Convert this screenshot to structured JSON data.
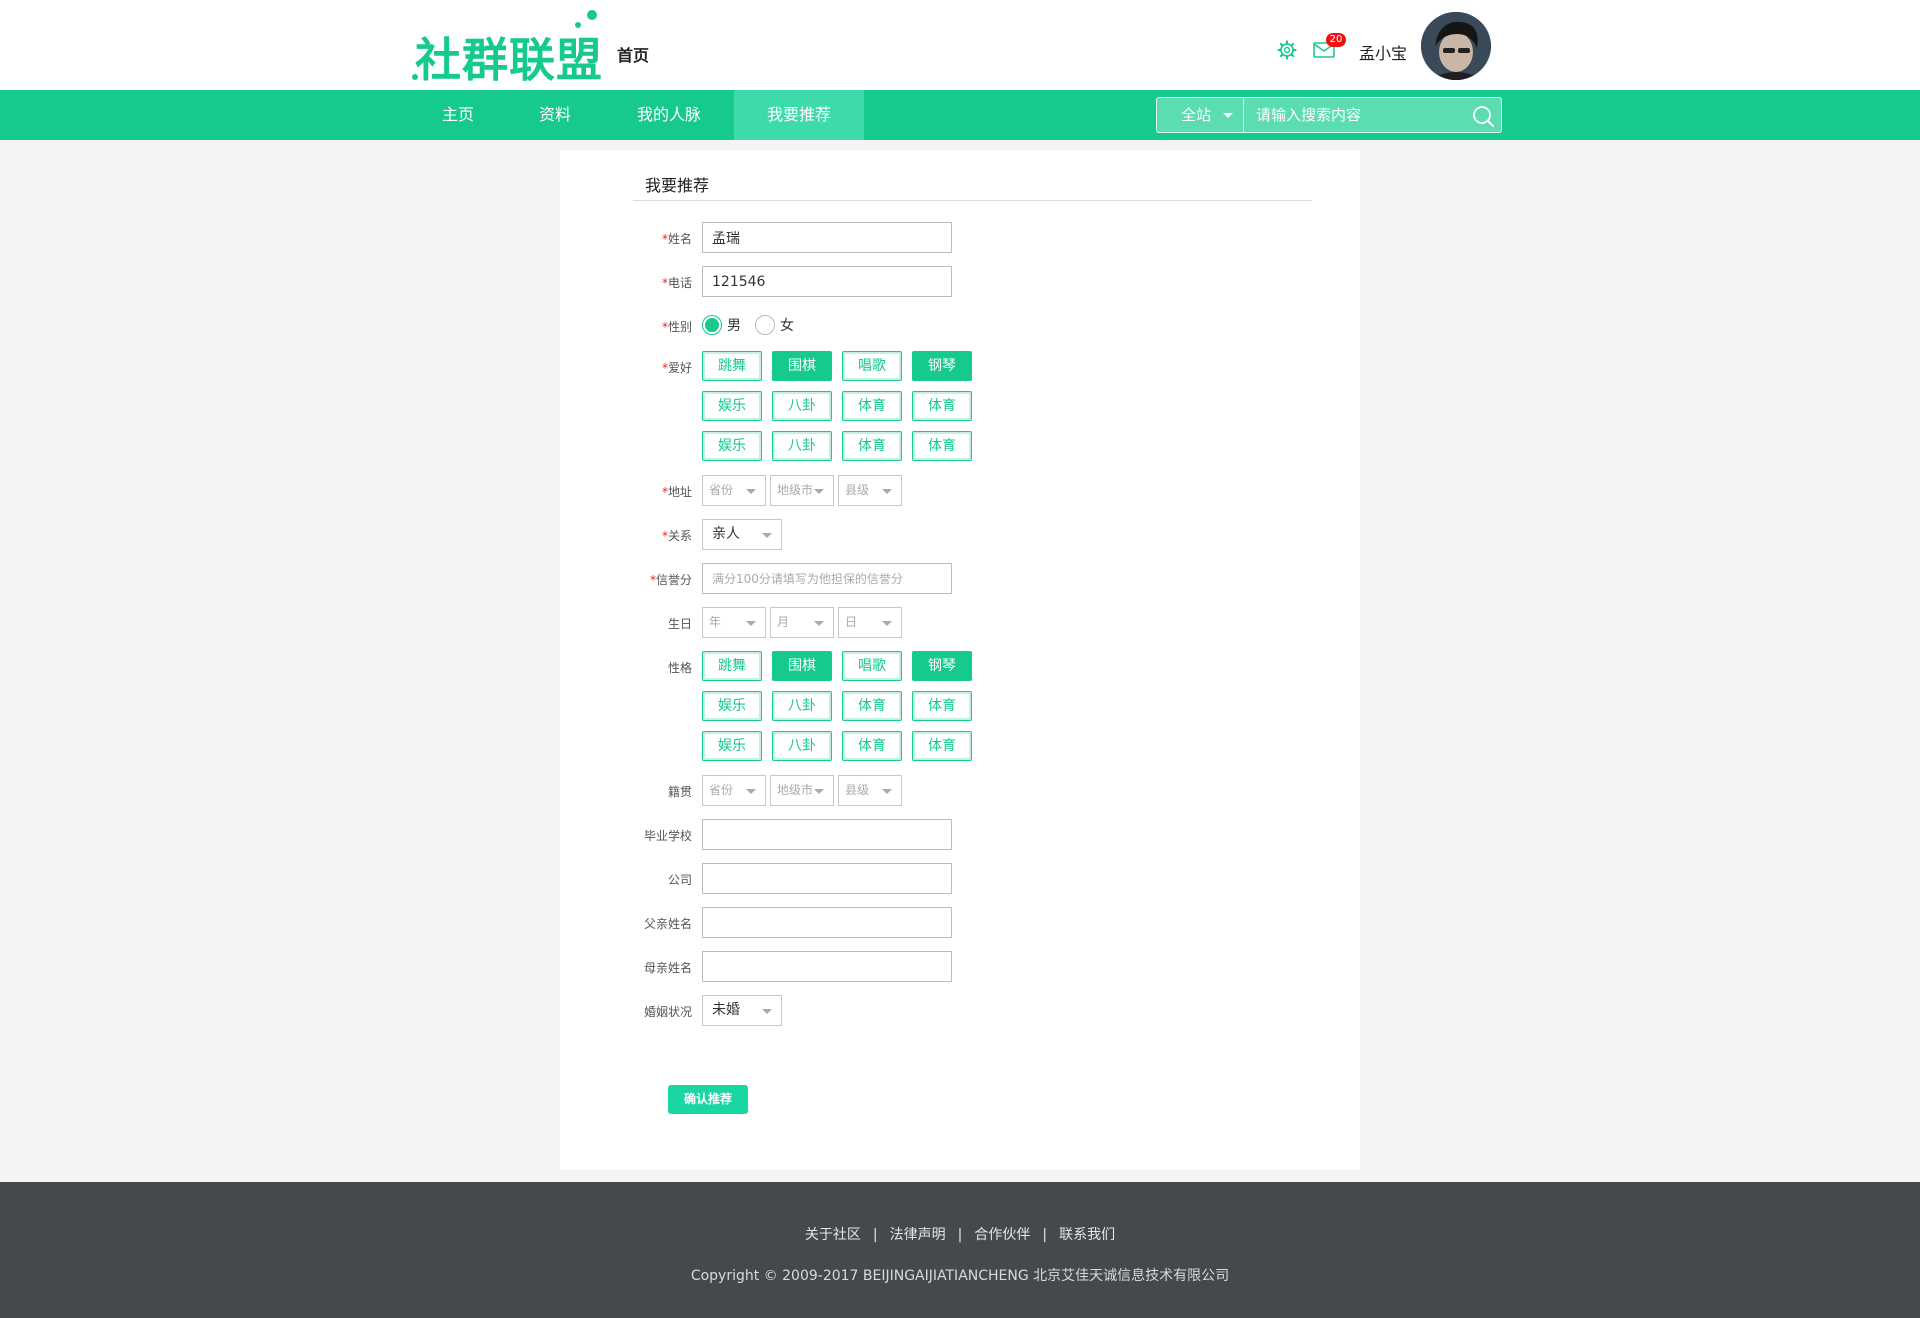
{
  "header": {
    "logo_text": "社群联盟",
    "home_link": "首页",
    "notification_count": "20",
    "username": "孟小宝"
  },
  "nav": {
    "items": [
      {
        "label": "主页"
      },
      {
        "label": "资料"
      },
      {
        "label": "我的人脉"
      },
      {
        "label": "我要推荐",
        "active": true
      }
    ],
    "search": {
      "scope": "全站",
      "placeholder": "请输入搜索内容"
    }
  },
  "form": {
    "title": "我要推荐",
    "required_mark": "*",
    "name": {
      "label": "姓名",
      "value": "孟瑞"
    },
    "phone": {
      "label": "电话",
      "value": "121546"
    },
    "gender": {
      "label": "性别",
      "options": [
        {
          "label": "男",
          "checked": true
        },
        {
          "label": "女",
          "checked": false
        }
      ]
    },
    "hobby": {
      "label": "爱好",
      "tags": [
        {
          "label": "跳舞",
          "selected": false
        },
        {
          "label": "围棋",
          "selected": true
        },
        {
          "label": "唱歌",
          "selected": false
        },
        {
          "label": "钢琴",
          "selected": true
        },
        {
          "label": "娱乐",
          "selected": false
        },
        {
          "label": "八卦",
          "selected": false
        },
        {
          "label": "体育",
          "selected": false
        },
        {
          "label": "体育",
          "selected": false
        },
        {
          "label": "娱乐",
          "selected": false
        },
        {
          "label": "八卦",
          "selected": false
        },
        {
          "label": "体育",
          "selected": false
        },
        {
          "label": "体育",
          "selected": false
        }
      ]
    },
    "address": {
      "label": "地址",
      "province": "省份",
      "city": "地级市",
      "county": "县级"
    },
    "relation": {
      "label": "关系",
      "value": "亲人"
    },
    "credit": {
      "label": "信誉分",
      "placeholder": "满分100分请填写为他担保的信誉分"
    },
    "birthday": {
      "label": "生日",
      "year": "年",
      "month": "月",
      "day": "日"
    },
    "personality": {
      "label": "性格",
      "tags": [
        {
          "label": "跳舞",
          "selected": false
        },
        {
          "label": "围棋",
          "selected": true
        },
        {
          "label": "唱歌",
          "selected": false
        },
        {
          "label": "钢琴",
          "selected": true
        },
        {
          "label": "娱乐",
          "selected": false
        },
        {
          "label": "八卦",
          "selected": false
        },
        {
          "label": "体育",
          "selected": false
        },
        {
          "label": "体育",
          "selected": false
        },
        {
          "label": "娱乐",
          "selected": false
        },
        {
          "label": "八卦",
          "selected": false
        },
        {
          "label": "体育",
          "selected": false
        },
        {
          "label": "体育",
          "selected": false
        }
      ]
    },
    "native_place": {
      "label": "籍贯",
      "province": "省份",
      "city": "地级市",
      "county": "县级"
    },
    "school": {
      "label": "毕业学校",
      "value": ""
    },
    "company": {
      "label": "公司",
      "value": ""
    },
    "father": {
      "label": "父亲姓名",
      "value": ""
    },
    "mother": {
      "label": "母亲姓名",
      "value": ""
    },
    "marital": {
      "label": "婚姻状况",
      "value": "未婚"
    },
    "submit_label": "确认推荐"
  },
  "footer": {
    "links": [
      "关于社区",
      "法律声明",
      "合作伙伴",
      "联系我们"
    ],
    "separator": "|",
    "copyright": "Copyright © 2009-2017 BEIJINGAIJIATIANCHENG 北京艾佳天诚信息技术有限公司"
  },
  "colors": {
    "brand_green": "#16c98d",
    "nav_active": "#3ddbab",
    "required_red": "#e22",
    "footer_bg": "#45484c"
  }
}
